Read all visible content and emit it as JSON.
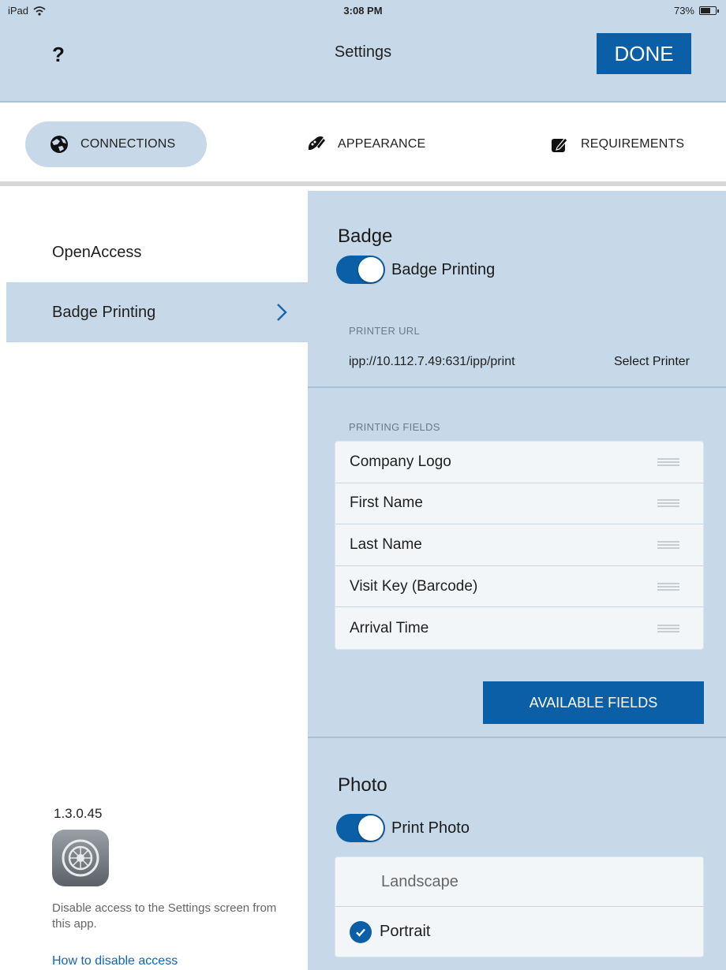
{
  "status_bar": {
    "device": "iPad",
    "time": "3:08 PM",
    "battery": "73%",
    "battery_level": 0.73
  },
  "header": {
    "help_label": "?",
    "title": "Settings",
    "done_label": "DONE"
  },
  "tabs": [
    {
      "label": "CONNECTIONS",
      "icon": "globe-icon",
      "active": true
    },
    {
      "label": "APPEARANCE",
      "icon": "paintbrush-icon",
      "active": false
    },
    {
      "label": "REQUIREMENTS",
      "icon": "pencil-icon",
      "active": false
    }
  ],
  "sidebar": {
    "items": [
      {
        "label": "OpenAccess",
        "selected": false
      },
      {
        "label": "Badge Printing",
        "selected": true
      }
    ],
    "version": "1.3.0.45",
    "disable_text": "Disable access to the Settings screen from this app.",
    "how_link": "How to disable access"
  },
  "badge": {
    "title": "Badge",
    "toggle_label": "Badge Printing",
    "toggle_on": true,
    "printer_url_label": "PRINTER URL",
    "printer_url": "ipp://10.112.7.49:631/ipp/print",
    "select_printer": "Select Printer",
    "printing_fields_label": "PRINTING FIELDS",
    "fields": [
      "Company Logo",
      "First Name",
      "Last Name",
      "Visit Key (Barcode)",
      "Arrival Time"
    ],
    "available_fields_label": "AVAILABLE FIELDS"
  },
  "photo": {
    "title": "Photo",
    "toggle_label": "Print Photo",
    "toggle_on": true,
    "orientations": [
      {
        "label": "Landscape",
        "selected": false
      },
      {
        "label": "Portrait",
        "selected": true
      }
    ]
  },
  "colors": {
    "accent": "#0b5fa6",
    "panel": "#c7d9e8",
    "link": "#1366b0"
  }
}
